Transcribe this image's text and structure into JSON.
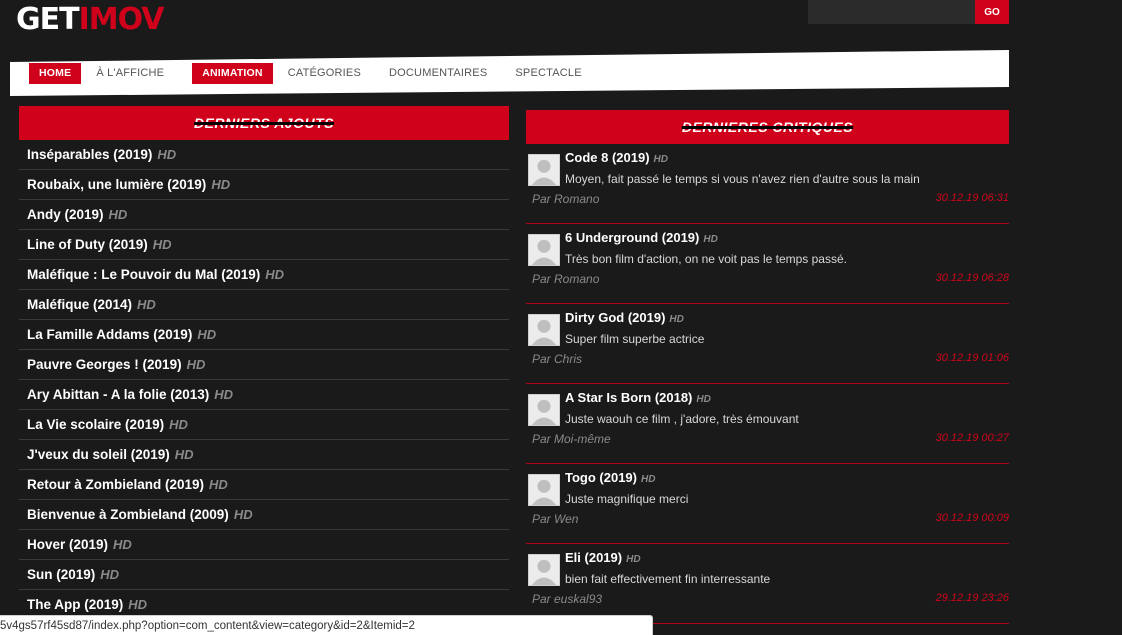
{
  "header": {
    "logo_part1": "GET",
    "logo_part2": "IMOV",
    "search": {
      "placeholder": "",
      "button_label": "GO"
    }
  },
  "nav": {
    "items": [
      {
        "label": "HOME",
        "active": true
      },
      {
        "label": "À L'AFFICHE",
        "active": false
      },
      {
        "label": "ANIMATION",
        "active": true
      },
      {
        "label": "CATÉGORIES",
        "active": false
      },
      {
        "label": "DOCUMENTAIRES",
        "active": false
      },
      {
        "label": "SPECTACLE",
        "active": false
      }
    ]
  },
  "recent": {
    "header": "DERNIERS AJOUTS",
    "items": [
      {
        "title": "Inséparables (2019)",
        "badge": "HD"
      },
      {
        "title": "Roubaix, une lumière (2019)",
        "badge": "HD"
      },
      {
        "title": "Andy (2019)",
        "badge": "HD"
      },
      {
        "title": "Line of Duty (2019)",
        "badge": "HD"
      },
      {
        "title": "Maléfique : Le Pouvoir du Mal (2019)",
        "badge": "HD"
      },
      {
        "title": "Maléfique (2014)",
        "badge": "HD"
      },
      {
        "title": "La Famille Addams (2019)",
        "badge": "HD"
      },
      {
        "title": "Pauvre Georges ! (2019)",
        "badge": "HD"
      },
      {
        "title": "Ary Abittan - A la folie (2013)",
        "badge": "HD"
      },
      {
        "title": "La Vie scolaire (2019)",
        "badge": "HD"
      },
      {
        "title": "J'veux du soleil (2019)",
        "badge": "HD"
      },
      {
        "title": "Retour à Zombieland (2019)",
        "badge": "HD"
      },
      {
        "title": "Bienvenue à Zombieland (2009)",
        "badge": "HD"
      },
      {
        "title": "Hover (2019)",
        "badge": "HD"
      },
      {
        "title": "Sun (2019)",
        "badge": "HD"
      },
      {
        "title": "The App (2019)",
        "badge": "HD"
      }
    ]
  },
  "reviews": {
    "header": "DERNIERES CRITIQUES",
    "items": [
      {
        "title": "Code 8 (2019)",
        "badge": "HD",
        "text": "Moyen, fait passé le temps si vous n'avez rien d'autre sous la main",
        "author": "Par Romano",
        "date": "30.12.19 06:31"
      },
      {
        "title": "6 Underground (2019)",
        "badge": "HD",
        "text": "Très bon film d'action, on ne voit pas le temps passé.",
        "author": "Par Romano",
        "date": "30.12.19 06:28"
      },
      {
        "title": "Dirty God (2019)",
        "badge": "HD",
        "text": "Super film superbe actrice",
        "author": "Par Chris",
        "date": "30.12.19 01:06"
      },
      {
        "title": "A Star Is Born (2018)",
        "badge": "HD",
        "text": "Juste waouh ce film , j'adore, très émouvant",
        "author": "Par Moi-même",
        "date": "30.12.19 00:27"
      },
      {
        "title": "Togo (2019)",
        "badge": "HD",
        "text": "Juste magnifique merci",
        "author": "Par Wen",
        "date": "30.12.19 00:09"
      },
      {
        "title": "Eli (2019)",
        "badge": "HD",
        "text": "bien fait effectivement fin interressante",
        "author": "Par euskal93",
        "date": "29.12.19 23:26"
      }
    ]
  },
  "status_bar": {
    "url": "5v4gs57rf45sd87/index.php?option=com_content&view=category&id=2&Itemid=2"
  },
  "colors": {
    "accent": "#d0021b",
    "background": "#1a1a1a",
    "muted": "#8a8a8a"
  }
}
